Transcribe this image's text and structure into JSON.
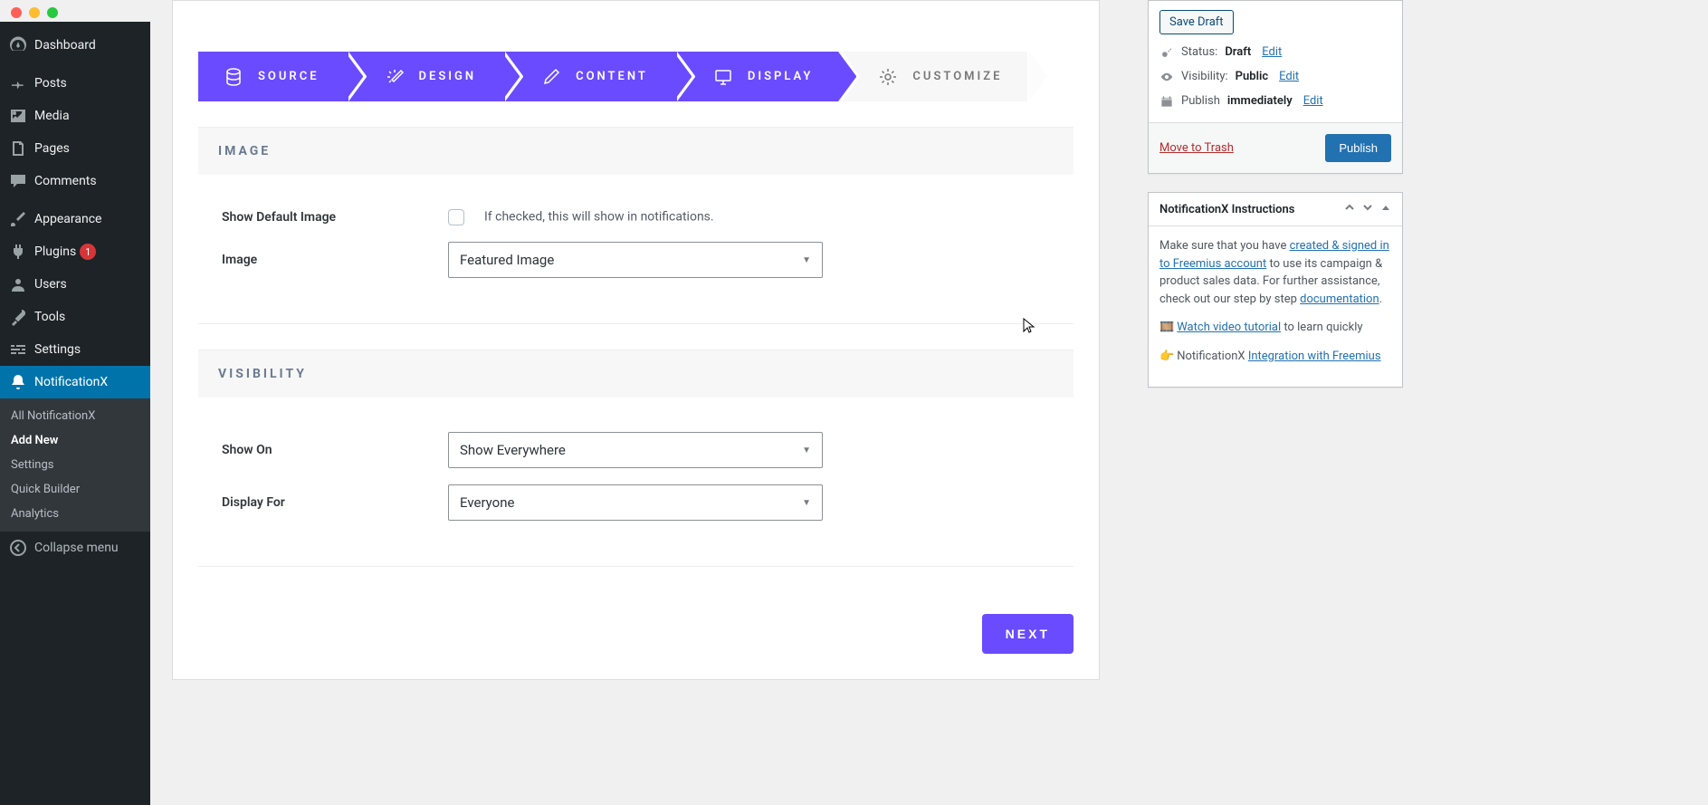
{
  "sidebar": {
    "items": [
      {
        "label": "Dashboard"
      },
      {
        "label": "Posts"
      },
      {
        "label": "Media"
      },
      {
        "label": "Pages"
      },
      {
        "label": "Comments"
      },
      {
        "label": "Appearance"
      },
      {
        "label": "Plugins",
        "badge": "1"
      },
      {
        "label": "Users"
      },
      {
        "label": "Tools"
      },
      {
        "label": "Settings"
      },
      {
        "label": "NotificationX"
      }
    ],
    "sub": [
      {
        "label": "All NotificationX"
      },
      {
        "label": "Add New"
      },
      {
        "label": "Settings"
      },
      {
        "label": "Quick Builder"
      },
      {
        "label": "Analytics"
      }
    ],
    "collapse": "Collapse menu"
  },
  "steps": {
    "source": "SOURCE",
    "design": "DESIGN",
    "content": "CONTENT",
    "display": "DISPLAY",
    "customize": "CUSTOMIZE"
  },
  "sections": {
    "image": {
      "title": "IMAGE",
      "show_default_label": "Show Default Image",
      "show_default_hint": "If checked, this will show in notifications.",
      "image_label": "Image",
      "image_value": "Featured Image"
    },
    "visibility": {
      "title": "VISIBILITY",
      "show_on_label": "Show On",
      "show_on_value": "Show Everywhere",
      "display_for_label": "Display For",
      "display_for_value": "Everyone"
    }
  },
  "next_label": "NEXT",
  "publish": {
    "save_draft": "Save Draft",
    "status_label": "Status: ",
    "status_value": "Draft",
    "status_edit": "Edit",
    "vis_label": "Visibility: ",
    "vis_value": "Public",
    "vis_edit": "Edit",
    "pub_label": "Publish ",
    "pub_value": "immediately",
    "pub_edit": "Edit",
    "trash": "Move to Trash",
    "publish_btn": "Publish"
  },
  "instructions": {
    "title": "NotificationX Instructions",
    "intro_pre": "Make sure that you have ",
    "link1": "created & signed in to Freemius account",
    "intro_mid": " to use its campaign & product sales data. For further assistance, check out our step by step ",
    "link2": "documentation",
    "dot": ".",
    "video_pre": "",
    "video_link": "Watch video tutorial",
    "video_post": " to learn quickly",
    "int_pre": "NotificationX ",
    "int_link": "Integration with Freemius"
  }
}
